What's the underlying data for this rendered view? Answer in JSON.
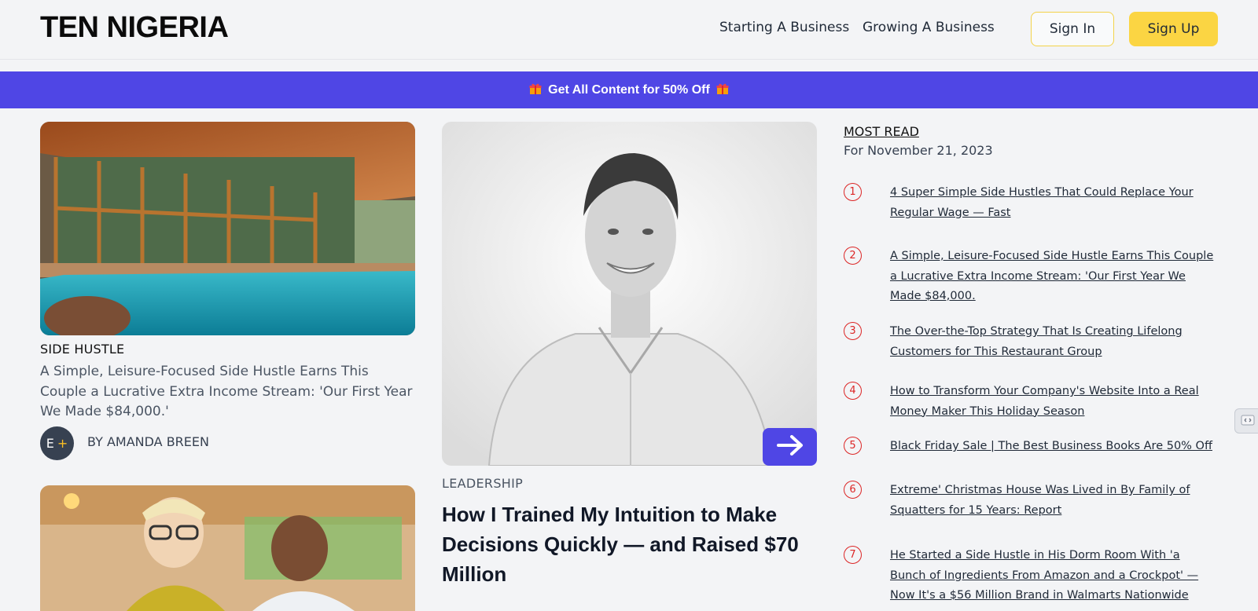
{
  "header": {
    "logo": "TEN NIGERIA",
    "nav": [
      "Starting A Business",
      "Growing A Business"
    ],
    "sign_in": "Sign In",
    "sign_up": "Sign Up"
  },
  "banner": {
    "text": "Get All Content for 50% Off",
    "icon": "gift-icon"
  },
  "left_card": {
    "category": "SIDE HUSTLE",
    "excerpt": "A Simple, Leisure-Focused Side Hustle Earns This Couple a Lucrative Extra Income Stream: 'Our First Year We Made $84,000.'",
    "avatar_text": "E",
    "avatar_badge": "+",
    "byline": "BY AMANDA BREEN"
  },
  "feature": {
    "category": "LEADERSHIP",
    "title": "How I Trained My Intuition to Make Decisions Quickly — and Raised $70 Million",
    "arrow_icon": "arrow-right-icon"
  },
  "most_read": {
    "heading": "MOST READ",
    "date": "For November 21, 2023",
    "items": [
      {
        "num": "1",
        "title": "4 Super Simple Side Hustles That Could Replace Your Regular Wage — Fast"
      },
      {
        "num": "2",
        "title": "A Simple, Leisure-Focused Side Hustle Earns This Couple a Lucrative Extra Income Stream: 'Our First Year We Made $84,000."
      },
      {
        "num": "3",
        "title": "The Over-the-Top Strategy That Is Creating Lifelong Customers for This Restaurant Group"
      },
      {
        "num": "4",
        "title": "How to Transform Your Company's Website Into a Real Money Maker This Holiday Season"
      },
      {
        "num": "5",
        "title": "Black Friday Sale | The Best Business Books Are 50% Off"
      },
      {
        "num": "6",
        "title": "Extreme' Christmas House Was Lived in By Family of Squatters for 15 Years: Report"
      },
      {
        "num": "7",
        "title": "He Started a Side Hustle in His Dorm Room With 'a Bunch of Ingredients From Amazon and a Crockpot' — Now It's a $56 Million Brand in Walmarts Nationwide"
      }
    ]
  },
  "colors": {
    "accent": "#4f46e5",
    "brand_yellow": "#fbd543",
    "number_red": "#dc2626",
    "background": "#f3f4f6"
  }
}
